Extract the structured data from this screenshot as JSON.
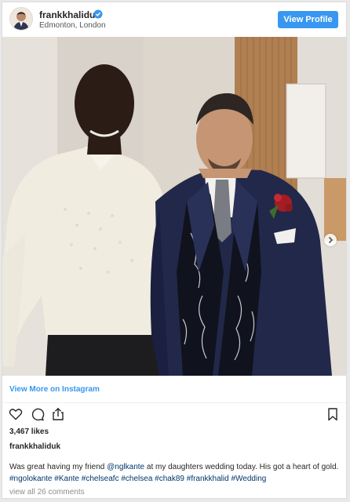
{
  "header": {
    "username": "frankkhaliduk",
    "location": "Edmonton, London",
    "view_profile_label": "View Profile",
    "avatar_icon": "profile-avatar",
    "verified_icon": "verified-badge-icon"
  },
  "post": {
    "carousel_next_icon": "chevron-right-icon",
    "view_more_label": "View More on Instagram",
    "likes": "3,467 likes",
    "caption_user": "frankkhaliduk",
    "caption_parts": [
      {
        "text": "Was great having my friend ",
        "tag": false
      },
      {
        "text": "@nglkante",
        "tag": true
      },
      {
        "text": " at my daughters wedding today. His got a heart of gold. ",
        "tag": false
      },
      {
        "text": "#ngolokante",
        "tag": true
      },
      {
        "text": " ",
        "tag": false
      },
      {
        "text": "#Kante",
        "tag": true
      },
      {
        "text": " ",
        "tag": false
      },
      {
        "text": "#chelseafc",
        "tag": true
      },
      {
        "text": " ",
        "tag": false
      },
      {
        "text": "#chelsea",
        "tag": true
      },
      {
        "text": " ",
        "tag": false
      },
      {
        "text": "#chak89",
        "tag": true
      },
      {
        "text": " ",
        "tag": false
      },
      {
        "text": "#frankkhalid",
        "tag": true
      },
      {
        "text": " ",
        "tag": false
      },
      {
        "text": "#Wedding",
        "tag": true
      }
    ],
    "view_comments": "view all 26 comments"
  },
  "actions": {
    "like_icon": "heart-icon",
    "comment_icon": "comment-icon",
    "share_icon": "share-icon",
    "save_icon": "bookmark-icon"
  },
  "colors": {
    "accent": "#3897f0",
    "hashtag": "#00376b",
    "muted": "#8e8e8e"
  }
}
